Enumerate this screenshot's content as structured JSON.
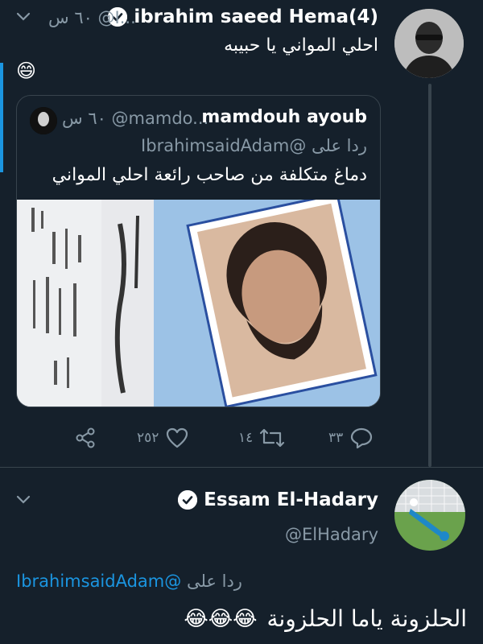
{
  "tweet1": {
    "author_name": "ibrahim saeed Hema(4)",
    "meta_text": "٦٠ س @I...",
    "text": "احلي المواني يا حبيبه",
    "emoji": "😄"
  },
  "quoted": {
    "author_name": "mamdouh ayoub",
    "meta_text": "٦٠ س @mamdo...",
    "reply_prefix": "ردا على",
    "reply_handle": "@IbrahimsaidAdam",
    "text": "دماغ متكلفة من صاحب رائعة احلي المواني"
  },
  "actions": {
    "replies": "٣٣",
    "retweets": "١٤",
    "likes": "٢٥٢"
  },
  "tweet2": {
    "author_name": "Essam El-Hadary",
    "handle": "@ElHadary",
    "reply_prefix": "ردا على",
    "reply_handle": "@IbrahimsaidAdam",
    "text": "الحلزونة ياما الحلزونة",
    "emojis": "😂😂😂"
  },
  "colors": {
    "background": "#15202b",
    "accent": "#1b95e0",
    "muted": "#8899a6",
    "border": "#38444d"
  }
}
